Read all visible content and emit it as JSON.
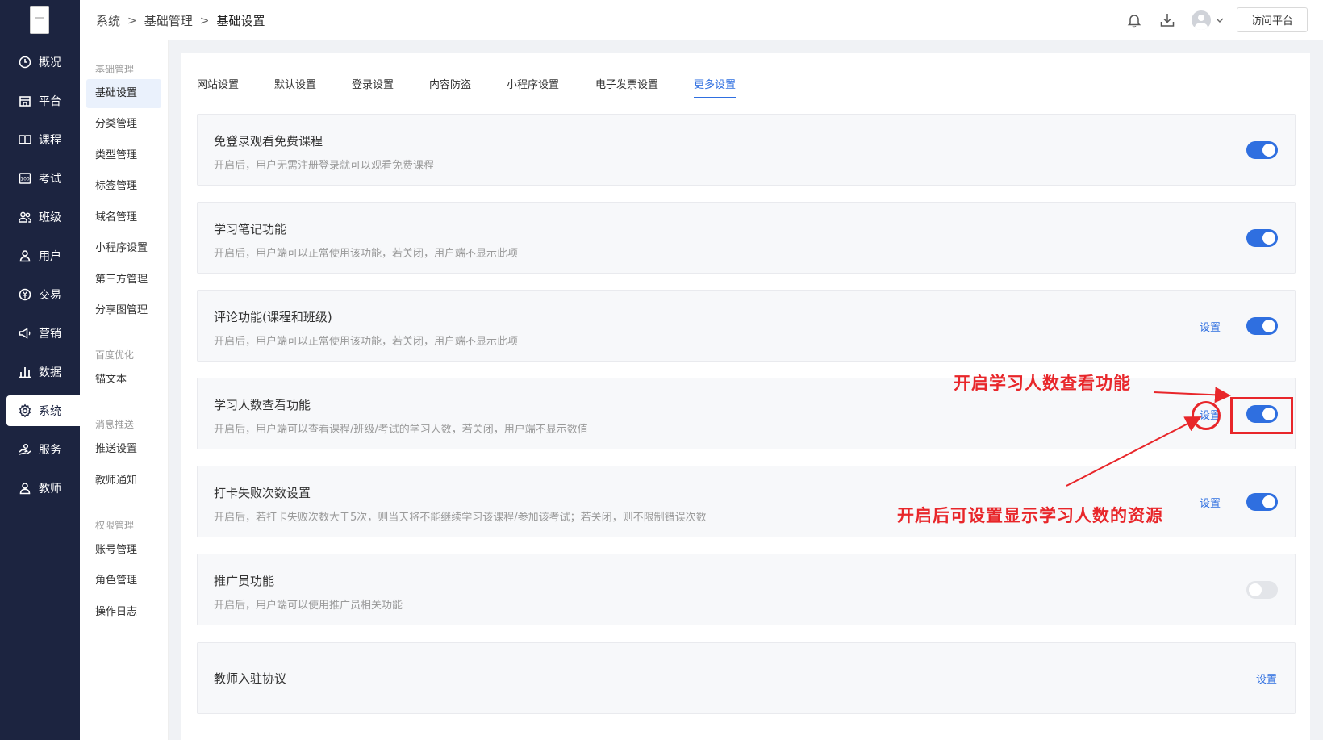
{
  "nav": {
    "items": [
      {
        "label": "概况",
        "icon": "clock-icon"
      },
      {
        "label": "平台",
        "icon": "store-icon"
      },
      {
        "label": "课程",
        "icon": "book-icon"
      },
      {
        "label": "考试",
        "icon": "exam-icon"
      },
      {
        "label": "班级",
        "icon": "group-icon"
      },
      {
        "label": "用户",
        "icon": "user-icon"
      },
      {
        "label": "交易",
        "icon": "yen-icon"
      },
      {
        "label": "营销",
        "icon": "megaphone-icon"
      },
      {
        "label": "数据",
        "icon": "bar-chart-icon"
      },
      {
        "label": "系统",
        "icon": "gear-icon"
      },
      {
        "label": "服务",
        "icon": "service-icon"
      },
      {
        "label": "教师",
        "icon": "teacher-icon"
      }
    ],
    "active": "系统"
  },
  "submenu": {
    "groups": [
      {
        "title": "基础管理",
        "items": [
          "基础设置",
          "分类管理",
          "类型管理",
          "标签管理",
          "域名管理",
          "小程序设置",
          "第三方管理",
          "分享图管理"
        ]
      },
      {
        "title": "百度优化",
        "items": [
          "锚文本"
        ]
      },
      {
        "title": "消息推送",
        "items": [
          "推送设置",
          "教师通知"
        ]
      },
      {
        "title": "权限管理",
        "items": [
          "账号管理",
          "角色管理",
          "操作日志"
        ]
      }
    ],
    "active": "基础设置"
  },
  "header": {
    "breadcrumb": [
      "系统",
      "基础管理",
      "基础设置"
    ],
    "separator": ">",
    "visit_button": "访问平台",
    "icons": [
      "bell-icon",
      "download-icon",
      "avatar",
      "chevron-down-icon"
    ]
  },
  "tabs": {
    "items": [
      "网站设置",
      "默认设置",
      "登录设置",
      "内容防盗",
      "小程序设置",
      "电子发票设置",
      "更多设置"
    ],
    "active": "更多设置"
  },
  "settings": [
    {
      "title": "免登录观看免费课程",
      "desc": "开启后，用户无需注册登录就可以观看免费课程",
      "link": "",
      "enabled": true
    },
    {
      "title": "学习笔记功能",
      "desc": "开启后，用户端可以正常使用该功能，若关闭，用户端不显示此项",
      "link": "",
      "enabled": true
    },
    {
      "title": "评论功能(课程和班级)",
      "desc": "开启后，用户端可以正常使用该功能，若关闭，用户端不显示此项",
      "link": "设置",
      "enabled": true
    },
    {
      "title": "学习人数查看功能",
      "desc": "开启后，用户端可以查看课程/班级/考试的学习人数，若关闭，用户端不显示数值",
      "link": "设置",
      "enabled": true
    },
    {
      "title": "打卡失败次数设置",
      "desc": "开启后，若打卡失败次数大于5次，则当天将不能继续学习该课程/参加该考试；若关闭，则不限制错误次数",
      "link": "设置",
      "enabled": true
    },
    {
      "title": "推广员功能",
      "desc": "开启后，用户端可以使用推广员相关功能",
      "link": "",
      "enabled": false
    },
    {
      "title": "教师入驻协议",
      "desc": "",
      "link": "设置",
      "enabled": null
    }
  ],
  "annotations": {
    "top": "开启学习人数查看功能",
    "bottom": "开启后可设置显示学习人数的资源",
    "color": "#e8262a"
  },
  "colors": {
    "nav_bg": "#1c2440",
    "accent": "#2f6fe0",
    "toggle_off": "#e3e5e9"
  }
}
